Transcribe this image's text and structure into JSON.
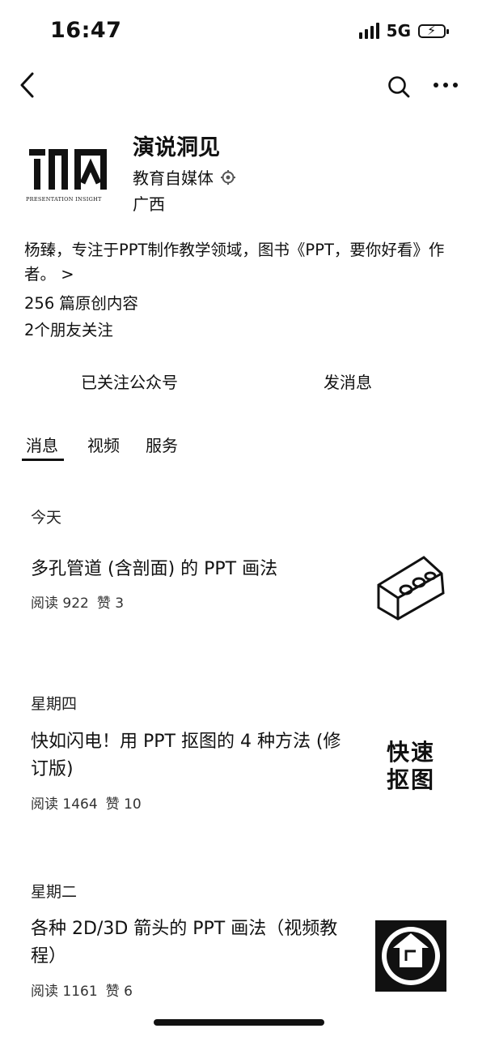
{
  "status_bar": {
    "time": "16:47",
    "network": "5G",
    "battery_icon": "battery-charging-icon"
  },
  "nav": {
    "back_icon": "chevron-left-icon",
    "search_icon": "search-icon",
    "more_icon": "more-icon"
  },
  "profile": {
    "logo_icon": "account-logo",
    "logo_text": "PRESENTATION INSIGHT",
    "name": "演说洞见",
    "type": "教育自媒体",
    "region": "广西",
    "bio": "杨臻，专注于PPT制作教学领域，图书《PPT，要你好看》作者。 >",
    "original_count": "256 篇原创内容",
    "friends_following": "2个朋友关注"
  },
  "actions": {
    "follow_label": "已关注公众号",
    "message_label": "发消息"
  },
  "tabs": [
    {
      "label": "消息",
      "active": true
    },
    {
      "label": "视频",
      "active": false
    },
    {
      "label": "服务",
      "active": false
    }
  ],
  "feed": [
    {
      "day": "今天",
      "title": "多孔管道 (含剖面) 的 PPT 画法",
      "reads": "阅读 922",
      "likes": "赞 3"
    },
    {
      "day": "星期四",
      "title": "快如闪电！用 PPT 抠图的 4 种方法 (修订版)",
      "reads": "阅读 1464",
      "likes": "赞 10",
      "thumb_text": "快速抠图"
    },
    {
      "day": "星期二",
      "title": "各种 2D/3D 箭头的 PPT 画法（视频教程）",
      "reads": "阅读 1161",
      "likes": "赞 6"
    }
  ]
}
